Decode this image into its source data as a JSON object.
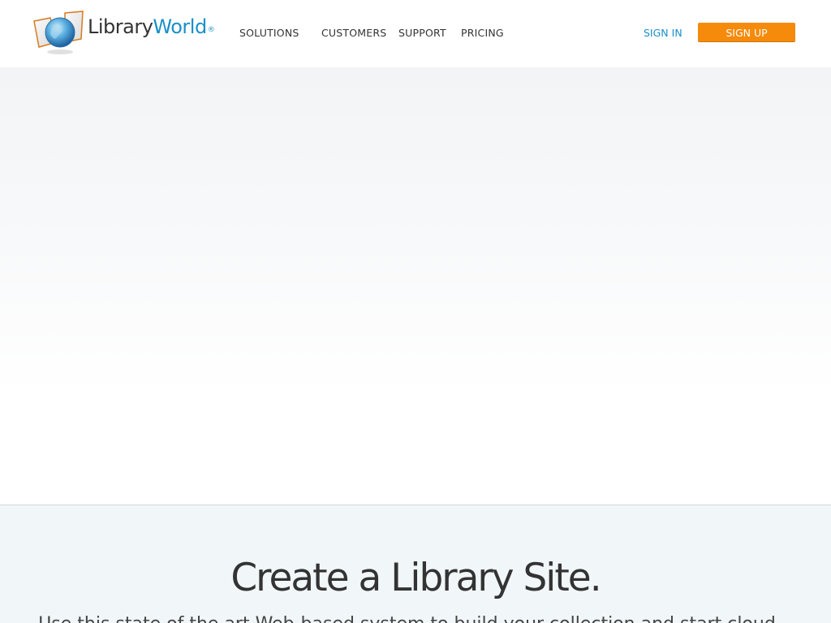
{
  "brand": {
    "name_part1": "Library",
    "name_part2": "World",
    "registered": "®",
    "colors": {
      "accent": "#1a8fc8",
      "text": "#333333"
    }
  },
  "nav": {
    "items": [
      {
        "label": "SOLUTIONS"
      },
      {
        "label": "CUSTOMERS"
      },
      {
        "label": "SUPPORT"
      },
      {
        "label": "PRICING"
      }
    ],
    "signin_label": "SIGN IN",
    "signup_label": "SIGN UP",
    "signup_color": "#f58a0b"
  },
  "section": {
    "title": "Create a Library Site.",
    "body": "Use this state of the art Web-based system to build your collection and start cloud..."
  }
}
